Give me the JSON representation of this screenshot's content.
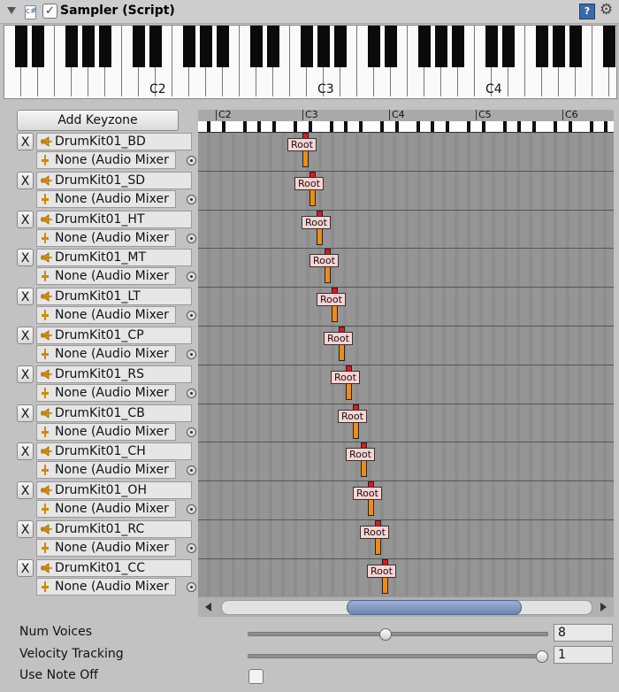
{
  "header": {
    "title": "Sampler (Script)",
    "script_icon_glyph": "c#",
    "help_glyph": "?",
    "gear_glyph": "⚙"
  },
  "piano": {
    "labels": [
      "C2",
      "C3",
      "C4"
    ]
  },
  "add_keyzone_label": "Add Keyzone",
  "keyzone_header": {
    "labels": [
      "C2",
      "C3",
      "C4",
      "C5",
      "C6"
    ]
  },
  "zones": [
    {
      "remove_label": "X",
      "clip": "DrumKit01_BD",
      "mixer": "None (Audio Mixer",
      "root_label": "Root"
    },
    {
      "remove_label": "X",
      "clip": "DrumKit01_SD",
      "mixer": "None (Audio Mixer",
      "root_label": "Root"
    },
    {
      "remove_label": "X",
      "clip": "DrumKit01_HT",
      "mixer": "None (Audio Mixer",
      "root_label": "Root"
    },
    {
      "remove_label": "X",
      "clip": "DrumKit01_MT",
      "mixer": "None (Audio Mixer",
      "root_label": "Root"
    },
    {
      "remove_label": "X",
      "clip": "DrumKit01_LT",
      "mixer": "None (Audio Mixer",
      "root_label": "Root"
    },
    {
      "remove_label": "X",
      "clip": "DrumKit01_CP",
      "mixer": "None (Audio Mixer",
      "root_label": "Root"
    },
    {
      "remove_label": "X",
      "clip": "DrumKit01_RS",
      "mixer": "None (Audio Mixer",
      "root_label": "Root"
    },
    {
      "remove_label": "X",
      "clip": "DrumKit01_CB",
      "mixer": "None (Audio Mixer",
      "root_label": "Root"
    },
    {
      "remove_label": "X",
      "clip": "DrumKit01_CH",
      "mixer": "None (Audio Mixer",
      "root_label": "Root"
    },
    {
      "remove_label": "X",
      "clip": "DrumKit01_OH",
      "mixer": "None (Audio Mixer",
      "root_label": "Root"
    },
    {
      "remove_label": "X",
      "clip": "DrumKit01_RC",
      "mixer": "None (Audio Mixer",
      "root_label": "Root"
    },
    {
      "remove_label": "X",
      "clip": "DrumKit01_CC",
      "mixer": "None (Audio Mixer",
      "root_label": "Root"
    }
  ],
  "properties": {
    "num_voices": {
      "label": "Num Voices",
      "value": "8",
      "slider_fraction": 0.46
    },
    "velocity_tracking": {
      "label": "Velocity Tracking",
      "value": "1",
      "slider_fraction": 1.0
    },
    "use_note_off": {
      "label": "Use Note Off",
      "checked": false
    }
  },
  "colors": {
    "root_label_bg": "#fbd3d3",
    "root_bar": "#f08c13",
    "root_cap": "#e6141b",
    "scroll_thumb": "#7f96c1"
  }
}
